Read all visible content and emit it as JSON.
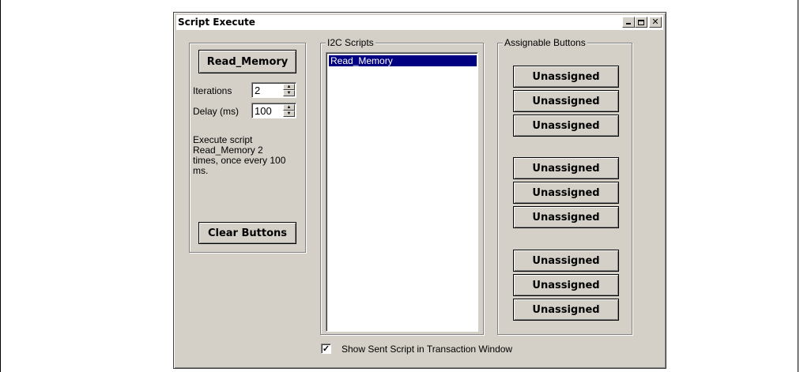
{
  "window": {
    "title": "Script Execute",
    "controls": {
      "minimize": "minimize-icon",
      "maximize": "maximize-icon",
      "close": "close-icon"
    }
  },
  "left_panel": {
    "run_button": "Read_Memory",
    "iterations_label": "Iterations",
    "iterations_value": "2",
    "delay_label": "Delay (ms)",
    "delay_value": "100",
    "description": "Execute script Read_Memory 2 times, once every 100 ms.",
    "clear_button": "Clear Buttons"
  },
  "scripts": {
    "label": "I2C Scripts",
    "items": [
      "Read_Memory"
    ],
    "selected_index": 0
  },
  "assignable": {
    "label": "Assignable Buttons",
    "buttons": [
      "Unassigned",
      "Unassigned",
      "Unassigned",
      "Unassigned",
      "Unassigned",
      "Unassigned",
      "Unassigned",
      "Unassigned",
      "Unassigned"
    ]
  },
  "footer": {
    "checkbox_label": "Show Sent Script in Transaction Window",
    "checked": true
  },
  "colors": {
    "face": "#d4d0c8",
    "selection": "#000080"
  }
}
